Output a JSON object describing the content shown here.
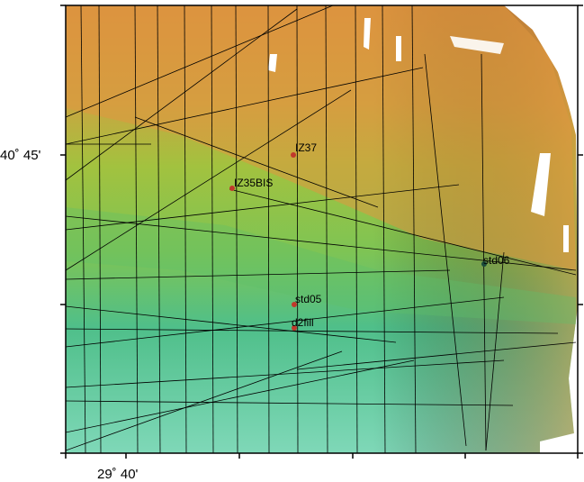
{
  "axes": {
    "y_tick_labels": [
      {
        "text": "40˚ 45'",
        "name": "lat-label-40-45"
      }
    ],
    "x_tick_labels": [
      {
        "text": "29˚ 40'",
        "name": "lon-label-29-40"
      }
    ]
  },
  "stations": [
    {
      "name": "IZ37",
      "color": "#c0392b"
    },
    {
      "name": "IZ35BIS",
      "color": "#c0392b"
    },
    {
      "name": "std06",
      "color": "#1a4a3a"
    },
    {
      "name": "std05",
      "color": "#c0392b"
    },
    {
      "name": "d2fill",
      "color": "#c0392b"
    }
  ],
  "colors": {
    "shallow": "#d98f3e",
    "mid": "#8cc63f",
    "deep": "#3cb8a0",
    "frame": "#000000"
  }
}
